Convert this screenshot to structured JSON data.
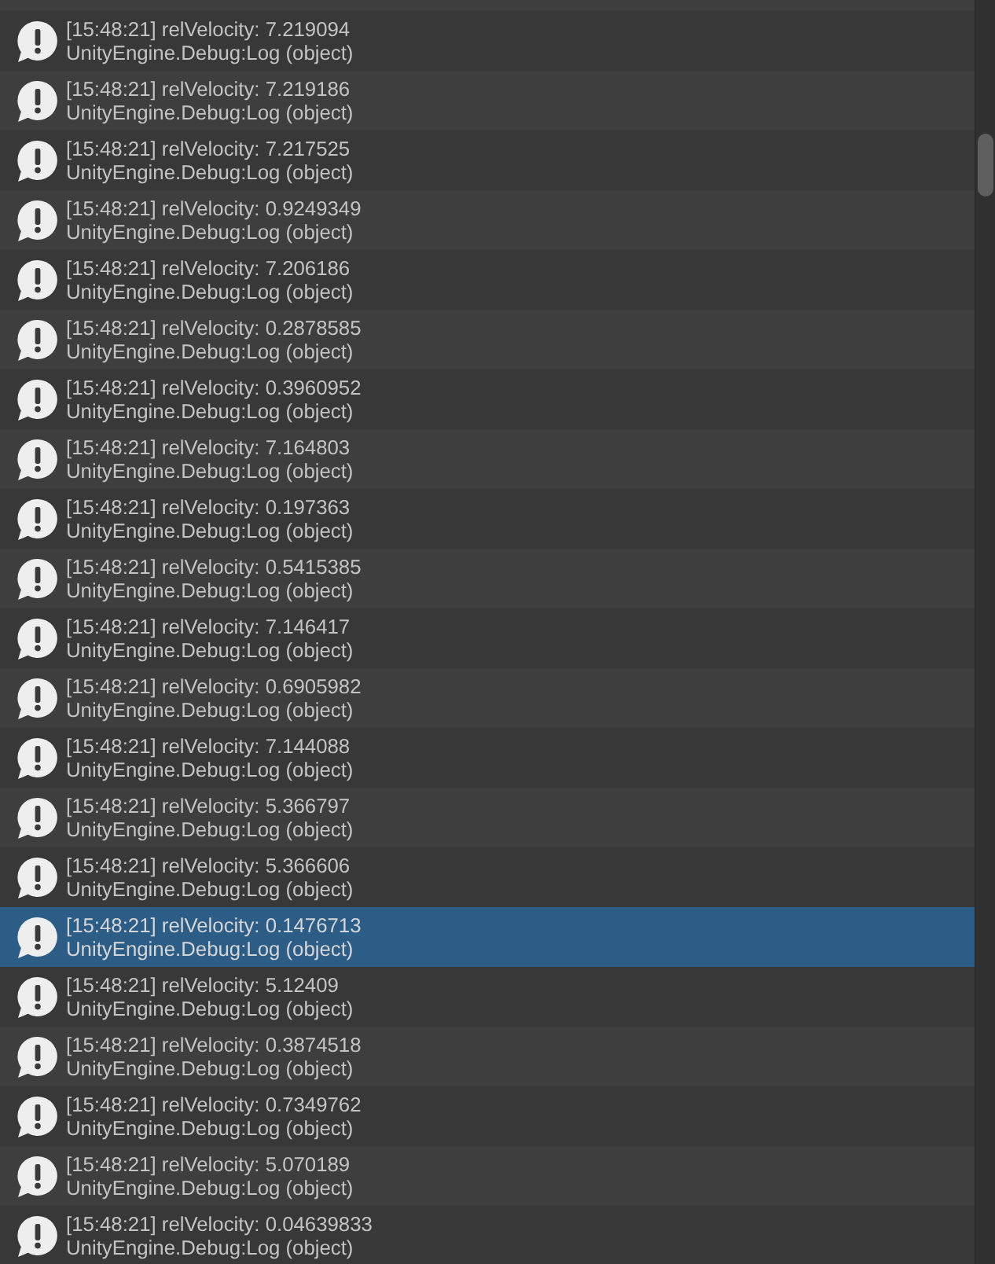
{
  "console": {
    "entries": [
      {
        "message": "[15:48:21] relVelocity: 7.219094",
        "trace": "UnityEngine.Debug:Log (object)",
        "selected": false
      },
      {
        "message": "[15:48:21] relVelocity: 7.219186",
        "trace": "UnityEngine.Debug:Log (object)",
        "selected": false
      },
      {
        "message": "[15:48:21] relVelocity: 7.217525",
        "trace": "UnityEngine.Debug:Log (object)",
        "selected": false
      },
      {
        "message": "[15:48:21] relVelocity: 0.9249349",
        "trace": "UnityEngine.Debug:Log (object)",
        "selected": false
      },
      {
        "message": "[15:48:21] relVelocity: 7.206186",
        "trace": "UnityEngine.Debug:Log (object)",
        "selected": false
      },
      {
        "message": "[15:48:21] relVelocity: 0.2878585",
        "trace": "UnityEngine.Debug:Log (object)",
        "selected": false
      },
      {
        "message": "[15:48:21] relVelocity: 0.3960952",
        "trace": "UnityEngine.Debug:Log (object)",
        "selected": false
      },
      {
        "message": "[15:48:21] relVelocity: 7.164803",
        "trace": "UnityEngine.Debug:Log (object)",
        "selected": false
      },
      {
        "message": "[15:48:21] relVelocity: 0.197363",
        "trace": "UnityEngine.Debug:Log (object)",
        "selected": false
      },
      {
        "message": "[15:48:21] relVelocity: 0.5415385",
        "trace": "UnityEngine.Debug:Log (object)",
        "selected": false
      },
      {
        "message": "[15:48:21] relVelocity: 7.146417",
        "trace": "UnityEngine.Debug:Log (object)",
        "selected": false
      },
      {
        "message": "[15:48:21] relVelocity: 0.6905982",
        "trace": "UnityEngine.Debug:Log (object)",
        "selected": false
      },
      {
        "message": "[15:48:21] relVelocity: 7.144088",
        "trace": "UnityEngine.Debug:Log (object)",
        "selected": false
      },
      {
        "message": "[15:48:21] relVelocity: 5.366797",
        "trace": "UnityEngine.Debug:Log (object)",
        "selected": false
      },
      {
        "message": "[15:48:21] relVelocity: 5.366606",
        "trace": "UnityEngine.Debug:Log (object)",
        "selected": false
      },
      {
        "message": "[15:48:21] relVelocity: 0.1476713",
        "trace": "UnityEngine.Debug:Log (object)",
        "selected": true
      },
      {
        "message": "[15:48:21] relVelocity: 5.12409",
        "trace": "UnityEngine.Debug:Log (object)",
        "selected": false
      },
      {
        "message": "[15:48:21] relVelocity: 0.3874518",
        "trace": "UnityEngine.Debug:Log (object)",
        "selected": false
      },
      {
        "message": "[15:48:21] relVelocity: 0.7349762",
        "trace": "UnityEngine.Debug:Log (object)",
        "selected": false
      },
      {
        "message": "[15:48:21] relVelocity: 5.070189",
        "trace": "UnityEngine.Debug:Log (object)",
        "selected": false
      },
      {
        "message": "[15:48:21] relVelocity: 0.04639833",
        "trace": "UnityEngine.Debug:Log (object)",
        "selected": false
      }
    ]
  }
}
